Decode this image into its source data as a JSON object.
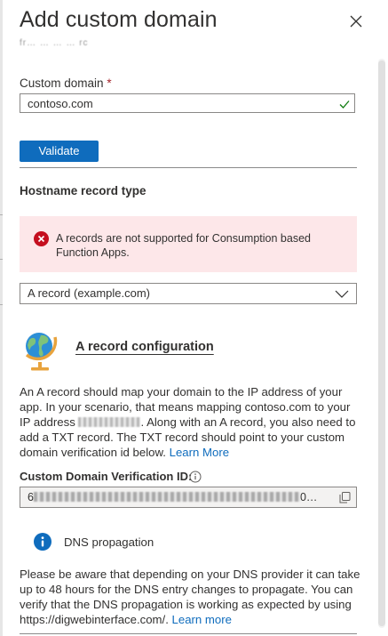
{
  "panel": {
    "title": "Add custom domain",
    "subtitle": "fr… … … … rc"
  },
  "domain": {
    "label": "Custom domain",
    "required": "*",
    "value": "contoso.com",
    "validate_label": "Validate"
  },
  "hostname": {
    "heading": "Hostname record type",
    "error": "A records are not supported for Consumption based Function Apps.",
    "selected_option": "A record (example.com)"
  },
  "a_record": {
    "heading": "A record configuration",
    "text_1": "An A record should map your domain to the IP address of your app. In your scenario, that means mapping contoso.com to your IP address ",
    "text_2": ". Along with an A record, you also need to add a TXT record. The TXT record should point to your custom domain verification id below. ",
    "learn_more": "Learn More"
  },
  "verification": {
    "label": "Custom Domain Verification ID:",
    "value_prefix": "6",
    "value_suffix": "0…"
  },
  "dns": {
    "title": "DNS propagation",
    "text": "Please be aware that depending on your DNS provider it can take up to 48 hours for the DNS entry changes to propagate. You can verify that the DNS propagation is working as expected by using https://digwebinterface.com/. ",
    "learn_more": "Learn more"
  },
  "colors": {
    "accent": "#0f6cbd",
    "error_bg": "#fde7e9",
    "error_icon": "#c50f1f",
    "success": "#107c10"
  },
  "icons": [
    "close-icon",
    "checkmark-icon",
    "error-icon",
    "chevron-down-icon",
    "globe-icon",
    "info-icon",
    "copy-icon"
  ]
}
